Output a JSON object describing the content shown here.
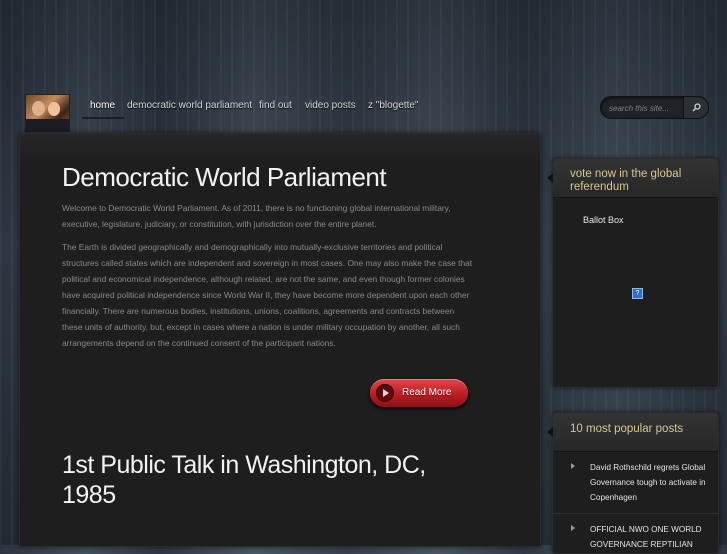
{
  "nav": {
    "items": [
      {
        "label": "home",
        "active": true
      },
      {
        "label": "democratic world parliament"
      },
      {
        "label": "find out"
      },
      {
        "label": "video posts"
      },
      {
        "label": "z \"blogette\""
      }
    ]
  },
  "search": {
    "placeholder": "search this site...",
    "button_icon": "magnifier-icon"
  },
  "posts": [
    {
      "title": "Democratic World Parliament",
      "paragraphs": [
        "Welcome to Democratic World Parliament. As of 2011, there is no functioning global international military, executive, legislature, judiciary, or constitution, with jurisdiction over the entire planet.",
        "The Earth is divided geographically and demographically into mutually-exclusive territories and political structures called states which are independent and sovereign in most cases. One may also make the case that political and economical independence, although related, are not the same, and even though former colonies have acquired political independence since World War II, they have become more dependent upon each other financially. There are numerous bodies, institutions, unions, coalitions, agreements and contracts between these units of authority, but, except in cases where a nation is under military occupation by another, all such arrangements depend on the continued consent of the participant nations."
      ],
      "read_more": "Read More"
    },
    {
      "title": "1st Public Talk in Washington, DC, 1985"
    }
  ],
  "sidebar": {
    "vote_widget": {
      "title": "vote now in the global referendum",
      "ballot_label": "Ballot Box",
      "broken_image_glyph": "?"
    },
    "popular_widget": {
      "title": "10 most popular posts",
      "items": [
        "David Rothschild regrets Global Governance tough to activate in Copenhagen",
        "OFFICIAL NWO ONE WORLD GOVERNANCE REPTILIAN"
      ]
    }
  },
  "colors": {
    "accent_red": "#c0262b",
    "widget_title": "#d8c790",
    "panel_bg": "#1e1e1e"
  }
}
